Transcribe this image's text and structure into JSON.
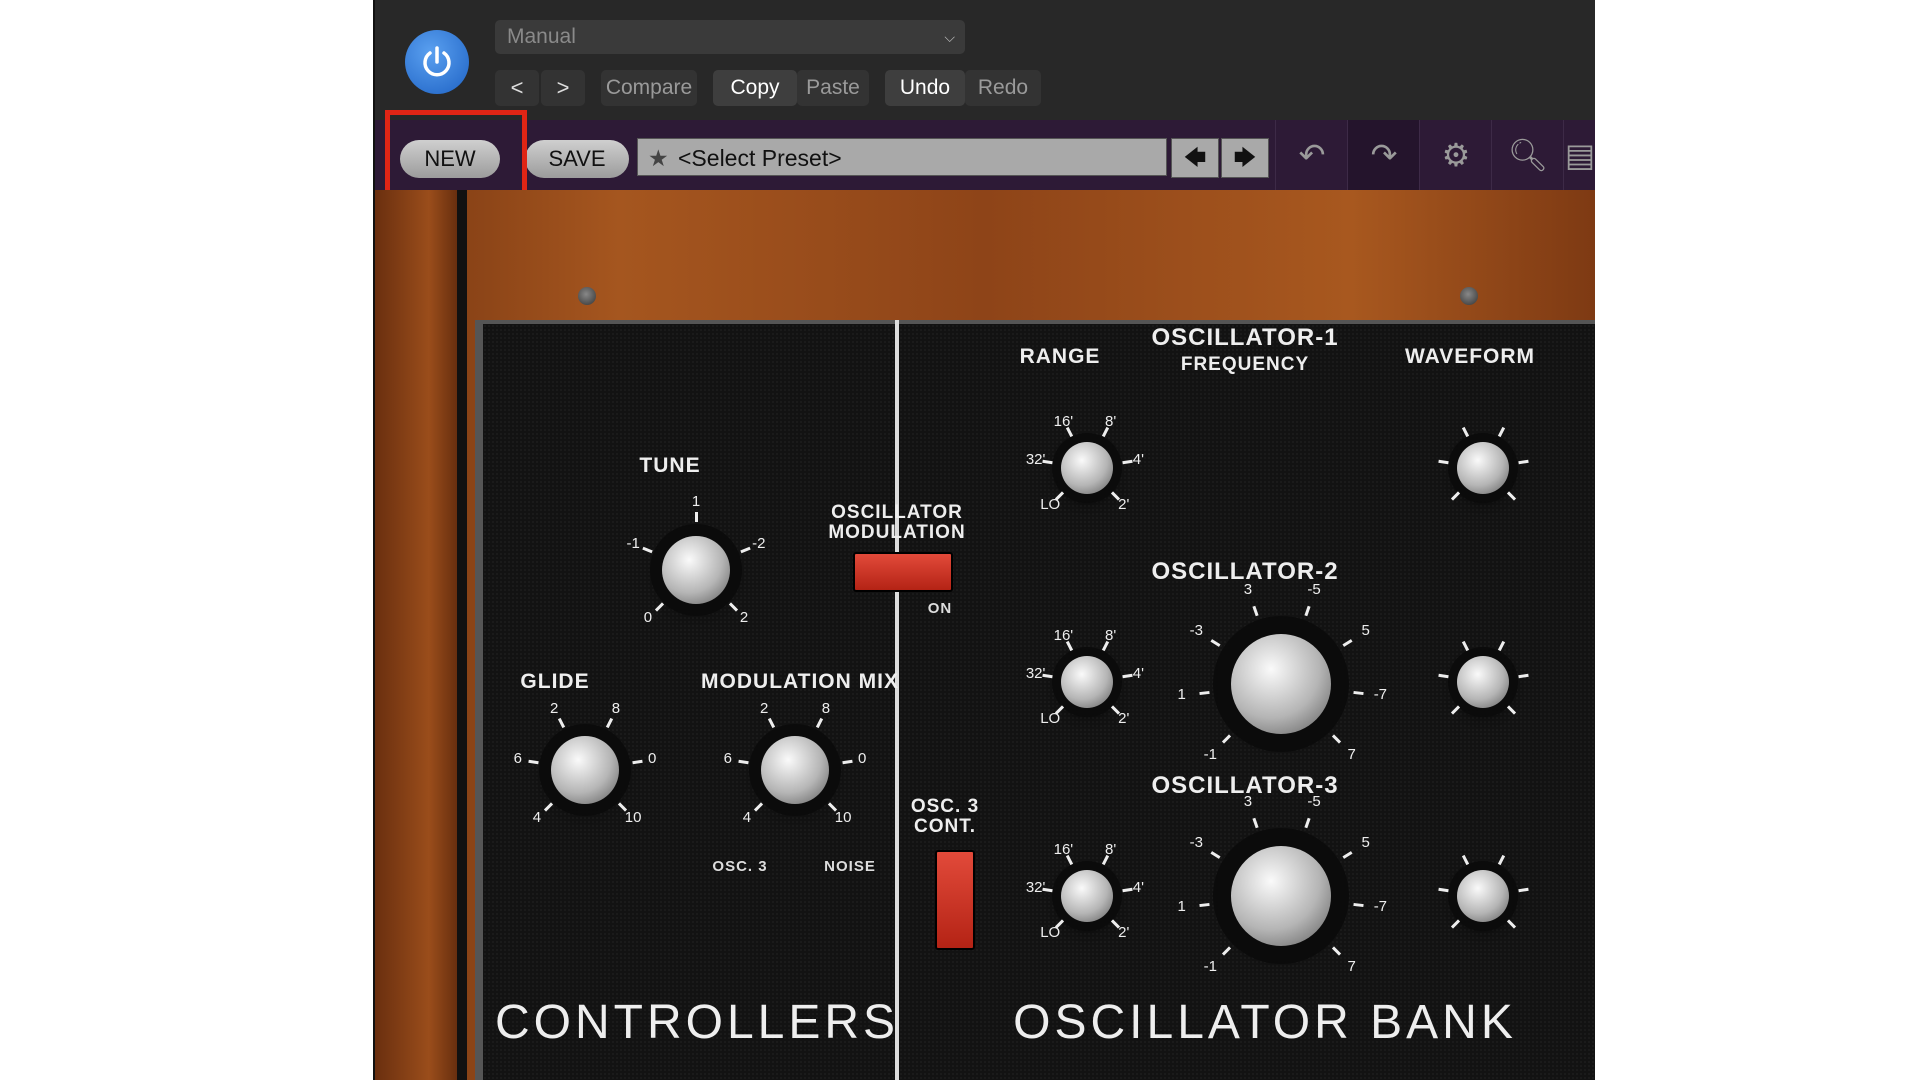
{
  "host": {
    "preset_value": "Manual",
    "nav_back": "<",
    "nav_forward": ">",
    "compare_label": "Compare",
    "copy_label": "Copy",
    "paste_label": "Paste",
    "undo_label": "Undo",
    "redo_label": "Redo"
  },
  "plugin_bar": {
    "new_label": "NEW",
    "save_label": "SAVE",
    "preset_placeholder": "<Select Preset>",
    "prev_arrow": "🡄",
    "next_arrow": "🡆"
  },
  "icons": {
    "power": "power-icon",
    "star": "star-icon",
    "undo": "undo-icon",
    "redo": "redo-icon",
    "settings": "gear-icon",
    "zoom": "zoom-icon"
  },
  "colors": {
    "highlight_box": "#e02515",
    "power_blue": "#1e62c4",
    "plugin_bar": "#2d1a36",
    "switch_red": "#d23322"
  },
  "controllers": {
    "section_title": "CONTROLLERS",
    "tune": {
      "label": "TUNE",
      "ticks": [
        "0",
        "-1",
        "1",
        "-2",
        "2"
      ]
    },
    "glide": {
      "label": "GLIDE",
      "ticks": [
        "4",
        "6",
        "2",
        "8",
        "0",
        "10"
      ]
    },
    "mod_mix": {
      "label": "MODULATION MIX",
      "ticks": [
        "4",
        "6",
        "2",
        "8",
        "0",
        "10"
      ],
      "left": "OSC. 3",
      "right": "NOISE"
    }
  },
  "oscillator_mod": {
    "label_1": "OSCILLATOR",
    "label_2": "MODULATION",
    "state": "ON"
  },
  "osc3_cont": {
    "label_1": "OSC. 3",
    "label_2": "CONT."
  },
  "oscillator_bank": {
    "section_title": "OSCILLATOR BANK",
    "range_label": "RANGE",
    "waveform_label": "WAVEFORM",
    "osc1_title": "OSCILLATOR-1",
    "osc1_sub": "FREQUENCY",
    "osc2_title": "OSCILLATOR-2",
    "osc3_title": "OSCILLATOR-3",
    "range_ticks": [
      "LO",
      "32'",
      "16'",
      "8'",
      "4'",
      "2'"
    ],
    "freq_ticks": [
      "-1",
      "1",
      "-3",
      "3",
      "-5",
      "5",
      "-7",
      "7"
    ]
  }
}
